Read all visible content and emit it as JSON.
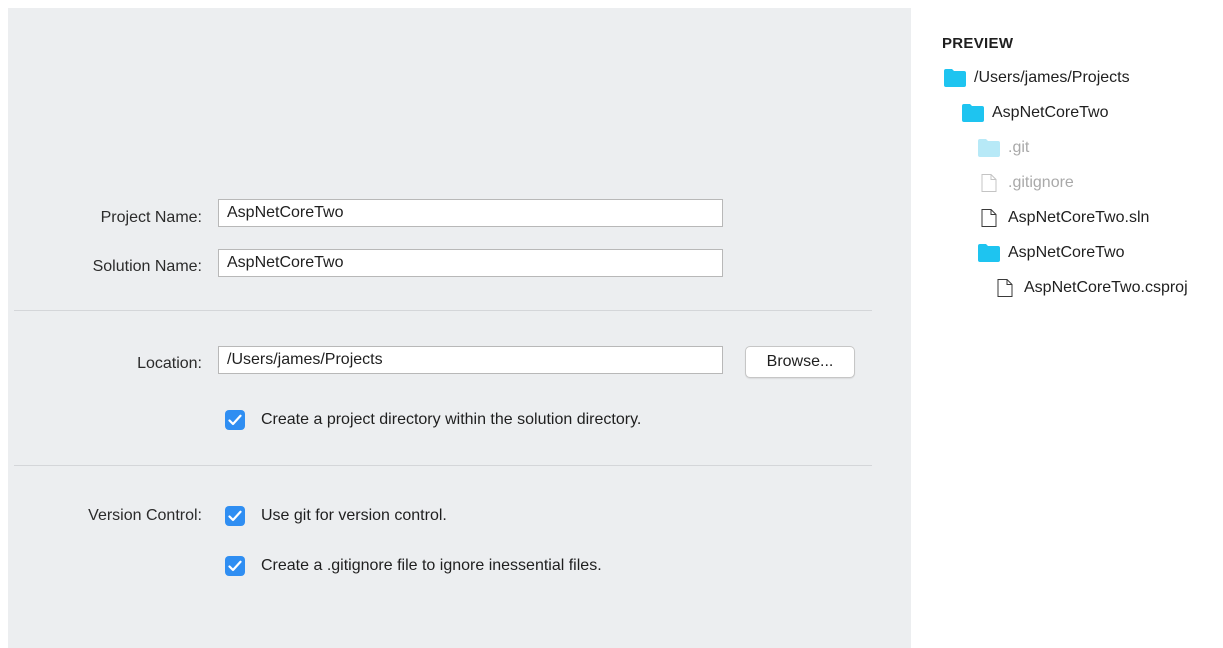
{
  "form": {
    "project_name_label": "Project Name:",
    "project_name_value": "AspNetCoreTwo",
    "solution_name_label": "Solution Name:",
    "solution_name_value": "AspNetCoreTwo",
    "location_label": "Location:",
    "location_value": "/Users/james/Projects",
    "browse_label": "Browse...",
    "create_project_dir_label": "Create a project directory within the solution directory.",
    "create_project_dir_checked": true,
    "version_control_label": "Version Control:",
    "use_git_label": "Use git for version control.",
    "use_git_checked": true,
    "gitignore_label": "Create a .gitignore file to ignore inessential files.",
    "gitignore_checked": true
  },
  "preview": {
    "title": "PREVIEW",
    "tree": [
      {
        "label": "/Users/james/Projects",
        "icon": "folder-icon",
        "dim": false
      },
      {
        "label": "AspNetCoreTwo",
        "icon": "folder-icon",
        "dim": false
      },
      {
        "label": ".git",
        "icon": "folder-icon",
        "dim": true
      },
      {
        "label": ".gitignore",
        "icon": "file-icon",
        "dim": true
      },
      {
        "label": "AspNetCoreTwo.sln",
        "icon": "file-icon",
        "dim": false
      },
      {
        "label": "AspNetCoreTwo",
        "icon": "folder-icon",
        "dim": false
      },
      {
        "label": "AspNetCoreTwo.csproj",
        "icon": "file-icon",
        "dim": false
      }
    ]
  },
  "colors": {
    "panel_bg": "#eceef0",
    "accent": "#2f8ef2",
    "folder": "#1ec4f0",
    "folder_dim": "#b7e9f7"
  }
}
